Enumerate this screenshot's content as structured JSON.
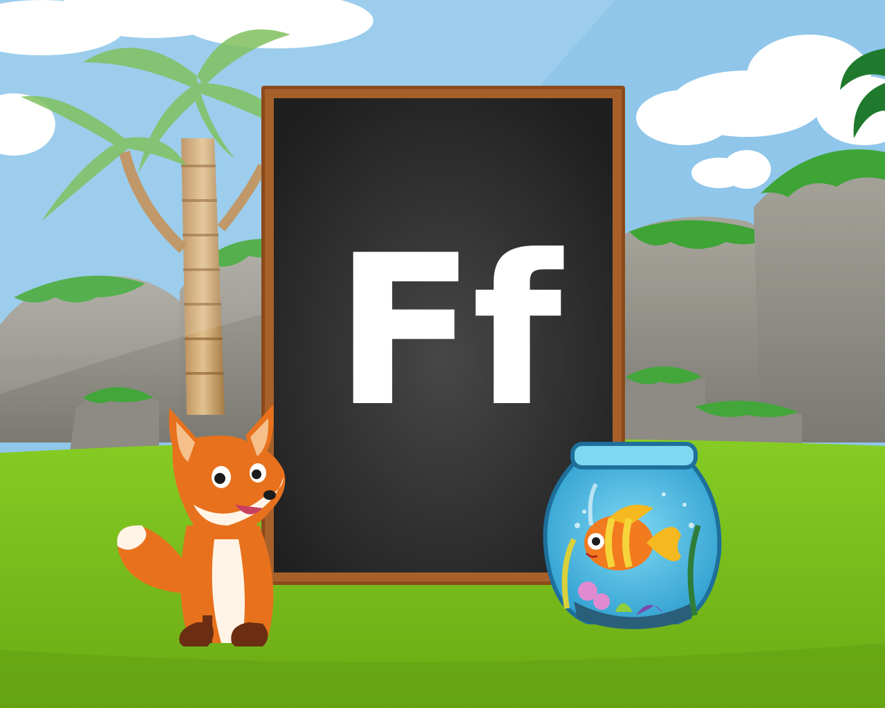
{
  "letter": "Ff",
  "colors": {
    "sky": "#8fc6ea",
    "grass": "#7cc21f",
    "chalkboard": "#2a2a2a",
    "frame": "#8a4a1c",
    "fox": "#e8711d",
    "fishbowl": "#58c2e6"
  }
}
